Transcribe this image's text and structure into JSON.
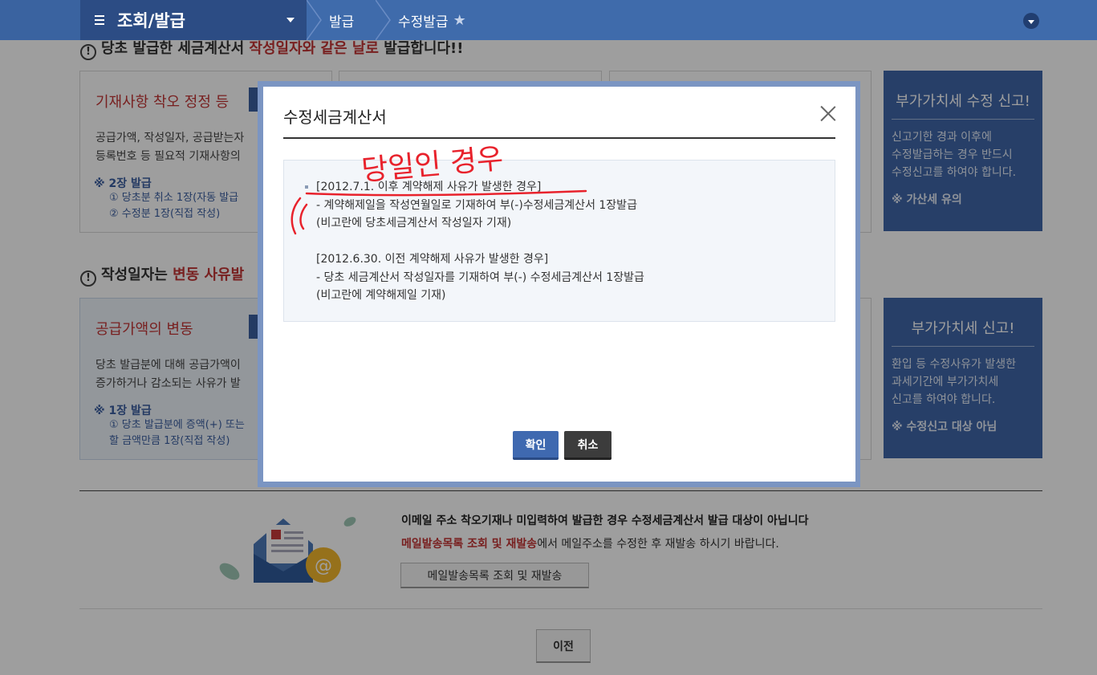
{
  "nav": {
    "menu_title": "조회/발급",
    "crumbs": [
      "발급",
      "수정발급"
    ]
  },
  "page": {
    "heading1": {
      "prefix": "당초 발급한 세금계산서 ",
      "highlight": "작성일자와 같은 날로",
      "suffix": " 발급합니다!!"
    },
    "heading2": {
      "prefix": "작성일자는 ",
      "highlight": "변동 사유발"
    },
    "box1": {
      "title": "기재사항 착오 정정 등",
      "lines": [
        "공급가액, 작성일자, 공급받는자",
        "등록번호 등 필요적 기재사항의"
      ],
      "sub": "※ 2장 발급",
      "subitems": [
        "① 당초분 취소 1장(자동 발급",
        "② 수정분 1장(직접 작성)"
      ]
    },
    "box2": {
      "title": "공급가액의 변동",
      "lines": [
        "당초 발급분에 대해 공급가액이",
        "증가하거나 감소되는 사유가 발"
      ],
      "sub": "※ 1장 발급",
      "subitems": [
        "① 당초 발급분에 증액(+) 또는",
        "할 금액만큼 1장(직접 작성)"
      ]
    },
    "side1": {
      "title": "부가가치세 수정 신고!",
      "lines": [
        "신고기한 경과 이후에",
        "수정발급하는 경우 반드시",
        "수정신고를 하여야 합니다."
      ],
      "note": "※ 가산세 유의"
    },
    "side2": {
      "title": "부가가치세 신고!",
      "lines": [
        "환입 등 수정사유가 발생한",
        "과세기간에 부가가치세",
        "신고를 하여야 합니다."
      ],
      "note": "※ 수정신고 대상 아님"
    },
    "email_notice": {
      "line1": "이메일 주소 착오기재나 미입력하여 발급한 경우 수정세금계산서 발급 대상이 아닙니다",
      "line2_link": "메일발송목록 조회 및 재발송",
      "line2_rest": "에서 메일주소를 수정한 후 재발송 하시기 바랍니다.",
      "button": "메일발송목록 조회 및 재발송"
    },
    "prev_button": "이전"
  },
  "modal": {
    "title": "수정세금계산서",
    "lines": [
      "[2012.7.1. 이후 계약해제 사유가 발생한 경우]",
      "- 계약해제일을 작성연월일로 기재하여 부(-)수정세금계산서 1장발급",
      "(비고란에 당초세금계산서 작성일자 기재)",
      "[2012.6.30. 이전 계약해제 사유가 발생한 경우]",
      "- 당초 세금계산서 작성일자를 기재하여 부(-) 수정세금계산서 1장발급",
      "(비고란에 계약해제일 기재)"
    ],
    "ok_label": "확인",
    "cancel_label": "취소",
    "annotation": "당일인 경우"
  },
  "colors": {
    "nav": "#3f6bab",
    "nav_dark": "#2c4c84",
    "accent_red": "#c23535",
    "annotation_red": "#e8222c",
    "button_blue": "#3f69b0"
  }
}
